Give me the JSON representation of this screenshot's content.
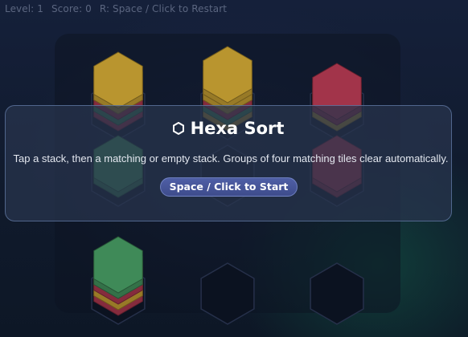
{
  "hud": {
    "level": "Level: 1",
    "score": "Score: 0",
    "restart_hint": "R: Space / Click to Restart"
  },
  "modal": {
    "title": "Hexa Sort",
    "title_icon": "hexagon-icon",
    "description": "Tap a stack, then a matching or empty stack. Groups of four matching tiles clear automatically.",
    "start_label": "Space / Click to Start"
  },
  "board": {
    "stacks": [
      {
        "tiles": [
          "red",
          "green",
          "red",
          "yellow",
          "yellow"
        ]
      },
      {
        "tiles": [
          "yellow",
          "green",
          "red",
          "yellow",
          "yellow",
          "yellow"
        ]
      },
      {
        "tiles": [
          "yellow",
          "red",
          "red"
        ]
      },
      {
        "tiles": [
          "green",
          "green"
        ]
      },
      {
        "tiles": []
      },
      {
        "tiles": [
          "red",
          "red"
        ]
      },
      {
        "tiles": [
          "red",
          "yellow",
          "red",
          "green",
          "green"
        ]
      },
      {
        "tiles": []
      },
      {
        "tiles": []
      }
    ]
  },
  "colors": {
    "yellow": "#b9952f",
    "red": "#a2344a",
    "green": "#3f8a58",
    "slot": "#0b1220",
    "slot_stroke": "#26304a",
    "accent": "#4a58a0"
  }
}
